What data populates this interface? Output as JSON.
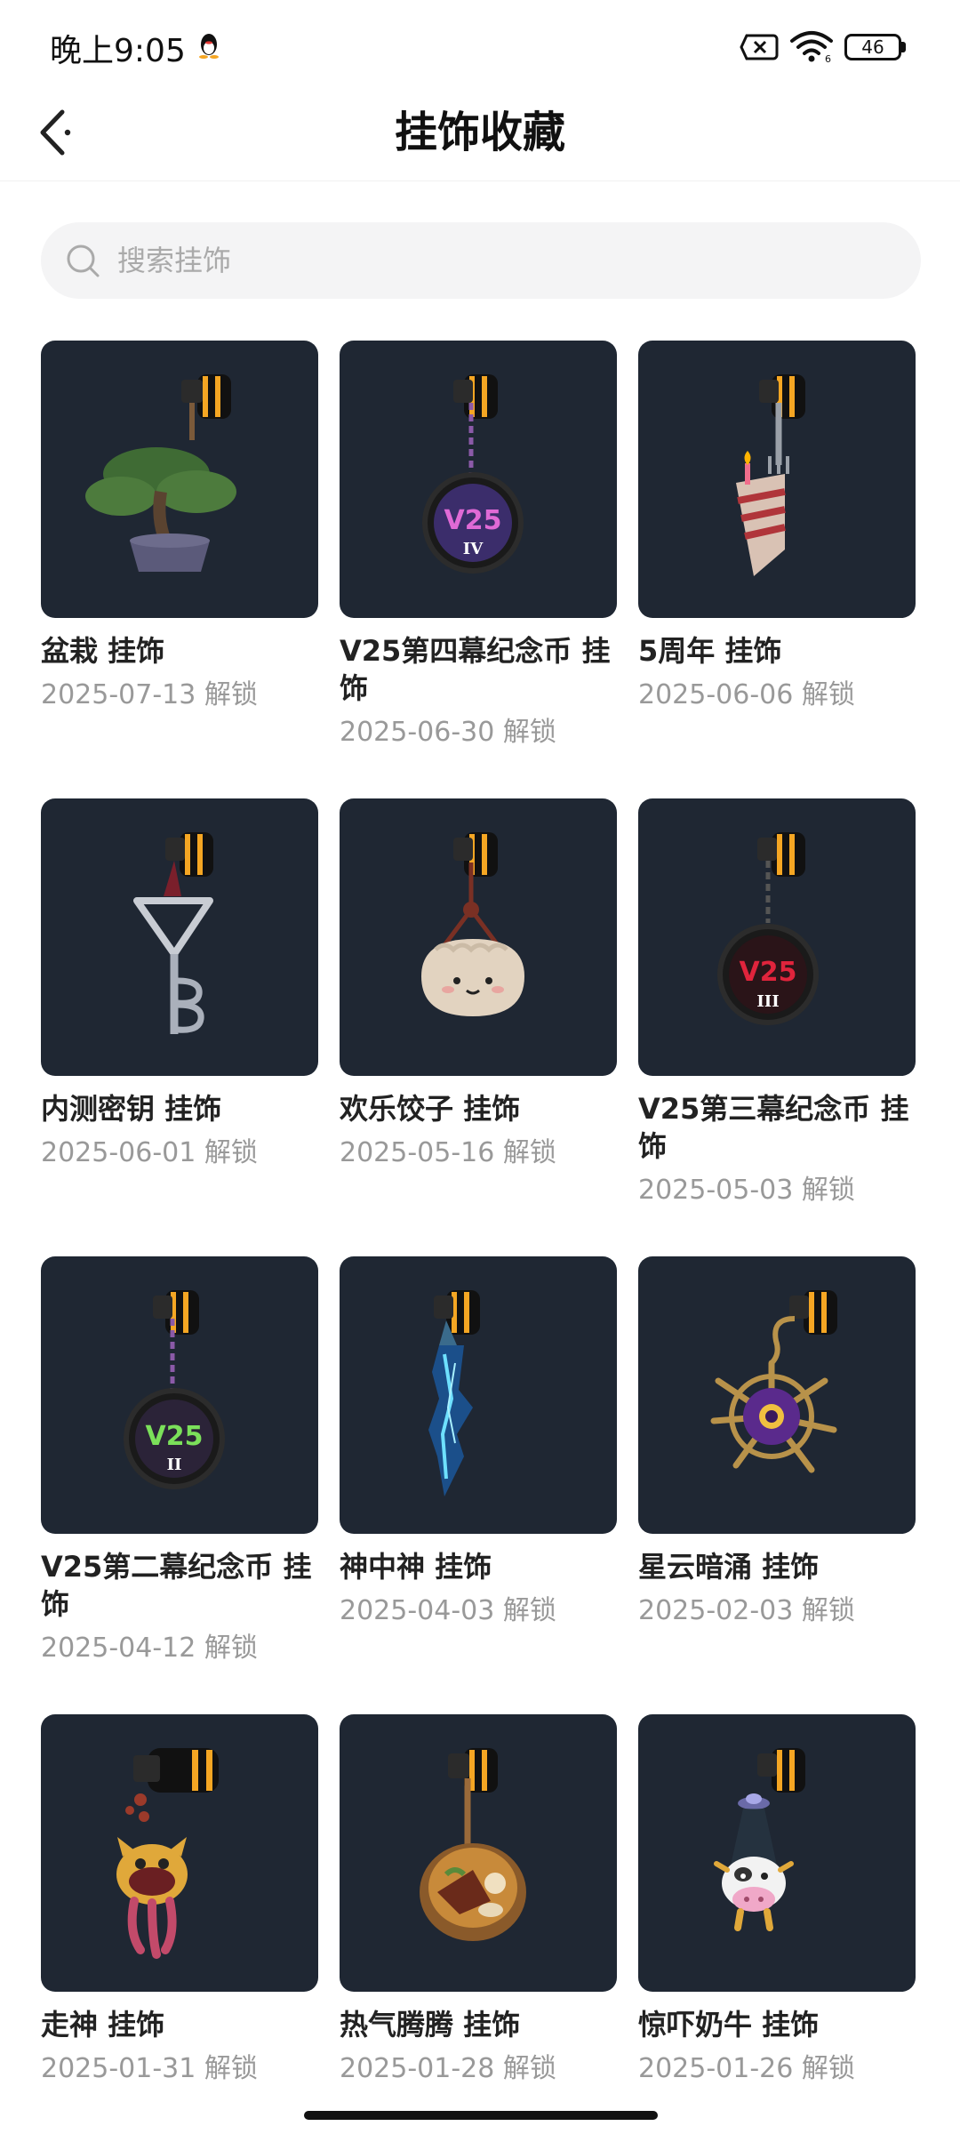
{
  "status": {
    "time": "晚上9:05",
    "battery": "46"
  },
  "header": {
    "title": "挂饰收藏"
  },
  "search": {
    "placeholder": "搜索挂饰",
    "value": ""
  },
  "items": [
    {
      "name": "盆栽 挂饰",
      "date": "2025-07-13 解锁",
      "icon": "bonsai-tree-charm"
    },
    {
      "name": "V25第四幕纪念币 挂饰",
      "date": "2025-06-30 解锁",
      "icon": "v25-coin-iv-charm"
    },
    {
      "name": "5周年 挂饰",
      "date": "2025-06-06 解锁",
      "icon": "cake-slice-charm"
    },
    {
      "name": "内测密钥 挂饰",
      "date": "2025-06-01 解锁",
      "icon": "key-charm"
    },
    {
      "name": "欢乐饺子 挂饰",
      "date": "2025-05-16 解锁",
      "icon": "dumpling-charm"
    },
    {
      "name": "V25第三幕纪念币 挂饰",
      "date": "2025-05-03 解锁",
      "icon": "v25-coin-iii-charm"
    },
    {
      "name": "V25第二幕纪念币 挂饰",
      "date": "2025-04-12 解锁",
      "icon": "v25-coin-ii-charm"
    },
    {
      "name": "神中神 挂饰",
      "date": "2025-04-03 解锁",
      "icon": "crystal-blade-charm"
    },
    {
      "name": "星云暗涌 挂饰",
      "date": "2025-02-03 解锁",
      "icon": "nebula-orb-charm"
    },
    {
      "name": "走神 挂饰",
      "date": "2025-01-31 解锁",
      "icon": "monster-charm"
    },
    {
      "name": "热气腾腾 挂饰",
      "date": "2025-01-28 解锁",
      "icon": "hot-bowl-charm"
    },
    {
      "name": "惊吓奶牛 挂饰",
      "date": "2025-01-26 解锁",
      "icon": "cow-ufo-charm"
    }
  ]
}
